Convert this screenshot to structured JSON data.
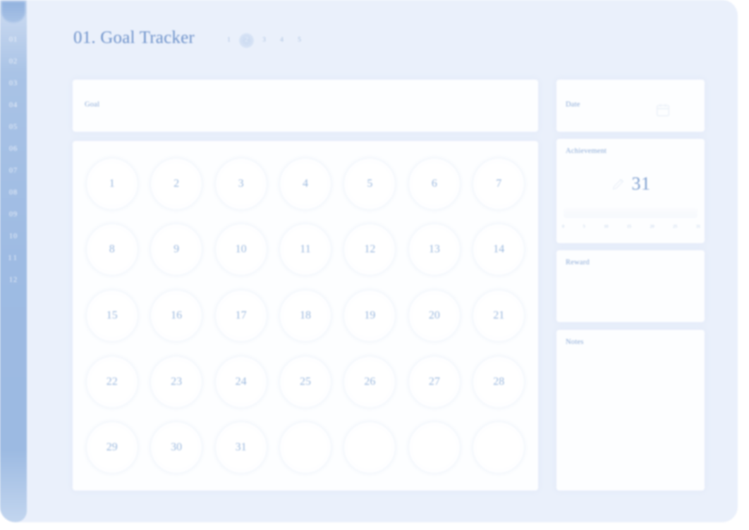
{
  "theme": {
    "page_background": "#ffffff",
    "canvas_background": "#eaf0fb",
    "sidebar_gradient_top": "#cfddf2",
    "sidebar_gradient_mid": "#9ebbe3",
    "card_background": "#fdfeff",
    "accent_text": "#7e9fd0",
    "label_text": "#8aa9d6",
    "muted_text": "#9cb9de"
  },
  "sidebar": {
    "name": "month-rail",
    "items": [
      {
        "label": "01",
        "active": true
      },
      {
        "label": "02",
        "active": false
      },
      {
        "label": "03",
        "active": false
      },
      {
        "label": "04",
        "active": false
      },
      {
        "label": "05",
        "active": false
      },
      {
        "label": "06",
        "active": false
      },
      {
        "label": "07",
        "active": false
      },
      {
        "label": "08",
        "active": false
      },
      {
        "label": "09",
        "active": false
      },
      {
        "label": "10",
        "active": false
      },
      {
        "label": "11",
        "active": false
      },
      {
        "label": "12",
        "active": false
      }
    ]
  },
  "header": {
    "title": "01. Goal Tracker",
    "pager": [
      {
        "label": "1",
        "active": false
      },
      {
        "label": "2",
        "active": true
      },
      {
        "label": "3",
        "active": false
      },
      {
        "label": "4",
        "active": false
      },
      {
        "label": "5",
        "active": false
      }
    ]
  },
  "goal": {
    "label": "Goal",
    "value": "",
    "placeholder": ""
  },
  "calendar": {
    "columns": 7,
    "rows": 5,
    "days": [
      "1",
      "2",
      "3",
      "4",
      "5",
      "6",
      "7",
      "8",
      "9",
      "10",
      "11",
      "12",
      "13",
      "14",
      "15",
      "16",
      "17",
      "18",
      "19",
      "20",
      "21",
      "22",
      "23",
      "24",
      "25",
      "26",
      "27",
      "28",
      "29",
      "30",
      "31",
      "",
      "",
      "",
      ""
    ]
  },
  "date": {
    "label": "Date",
    "value": "",
    "placeholder": "",
    "icon": "calendar-icon"
  },
  "achievement": {
    "label": "Achievement",
    "value": "31",
    "icon": "pencil-icon",
    "scale": [
      "0",
      "5",
      "10",
      "15",
      "20",
      "25",
      "31"
    ],
    "scale_min": 0,
    "scale_max": 31,
    "progress": 0
  },
  "reward": {
    "label": "Reward",
    "value": "",
    "placeholder": ""
  },
  "notes": {
    "label": "Notes",
    "value": "",
    "placeholder": ""
  }
}
